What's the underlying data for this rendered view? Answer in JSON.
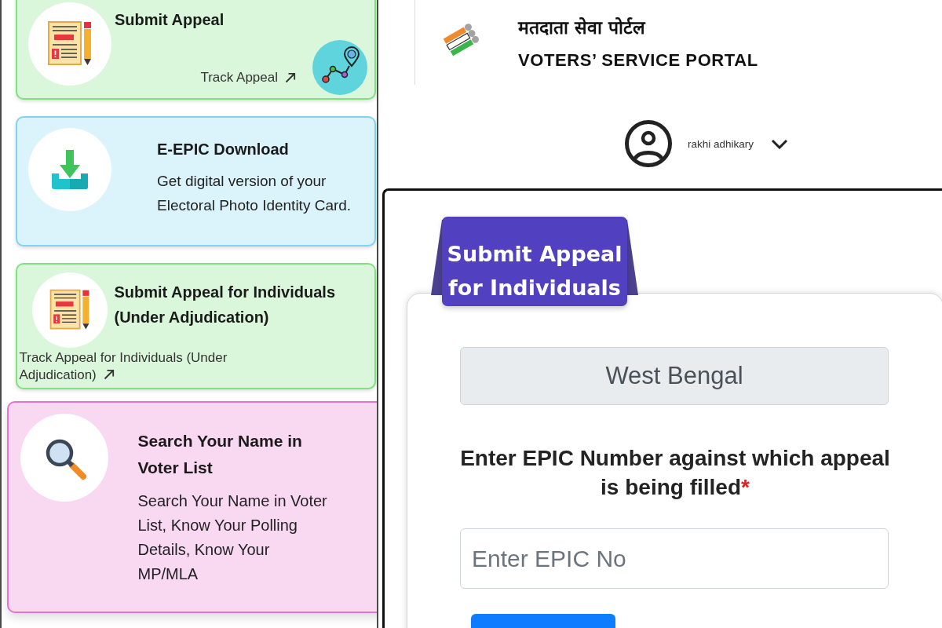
{
  "service_cards": [
    {
      "kind": "appeal",
      "color": "#7ee37e",
      "title": "Submit Appeal",
      "track_link": "Track Appeal"
    },
    {
      "kind": "download",
      "color": "#80d4f0",
      "title": "E-EPIC Download",
      "description": "Get digital version of your Electoral Photo Identity Card."
    },
    {
      "kind": "adjudication",
      "color": "#7ee37e",
      "title": "Submit Appeal for Individuals (Under Adjudication)",
      "track_link": "Track Appeal for Individuals (Under Adjudication)"
    },
    {
      "kind": "search",
      "color": "#e872d0",
      "title": "Search Your Name in Voter List",
      "description": "Search Your Name in Voter List, Know Your Polling Details, Know Your MP/MLA"
    }
  ],
  "portal": {
    "header": {
      "title_hindi": "मतदाता सेवा पोर्टल",
      "title": "VOTERS’ SERVICE PORTAL"
    },
    "user_menu": {
      "name": "rakhi adhikary"
    },
    "appeal_form": {
      "tab_label": "Submit Appeal for Individuals",
      "state_field": {
        "value": "West Bengal",
        "disabled": true
      },
      "epic_label": "Enter EPIC Number against which appeal is being filled",
      "required_mark": "*",
      "epic_field": {
        "placeholder": "Enter EPIC No"
      }
    }
  }
}
